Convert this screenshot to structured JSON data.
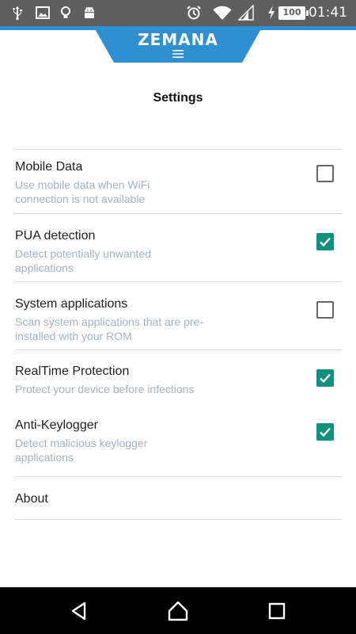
{
  "status_bar": {
    "time": "01:41",
    "battery_level": "100",
    "icons": [
      "usb-icon",
      "image-icon",
      "lightbulb-icon",
      "android-icon",
      "alarm-icon",
      "wifi-icon",
      "signal-icon",
      "charging-icon",
      "battery-icon"
    ]
  },
  "header": {
    "brand": "ZEMANA",
    "accent_color": "#2f8fd0",
    "menu_icon": "menu-icon"
  },
  "page": {
    "title": "Settings"
  },
  "settings": [
    {
      "title": "Mobile Data",
      "subtitle": "Use mobile data when WiFi connection is not available",
      "checked": false
    },
    {
      "title": "PUA detection",
      "subtitle": "Detect potentially unwanted applications",
      "checked": true
    },
    {
      "title": "System applications",
      "subtitle": "Scan system applications that are pre-installed with your ROM",
      "checked": false
    },
    {
      "title": "RealTime Protection",
      "subtitle": "Protect your device before infections",
      "checked": true
    },
    {
      "title": "Anti-Keylogger",
      "subtitle": "Detect malicious keylogger applications",
      "checked": true
    }
  ],
  "about": {
    "label": "About"
  },
  "checkbox_color": "#138f80",
  "nav_bar": {
    "buttons": [
      "back-icon",
      "home-icon",
      "recents-icon"
    ]
  }
}
